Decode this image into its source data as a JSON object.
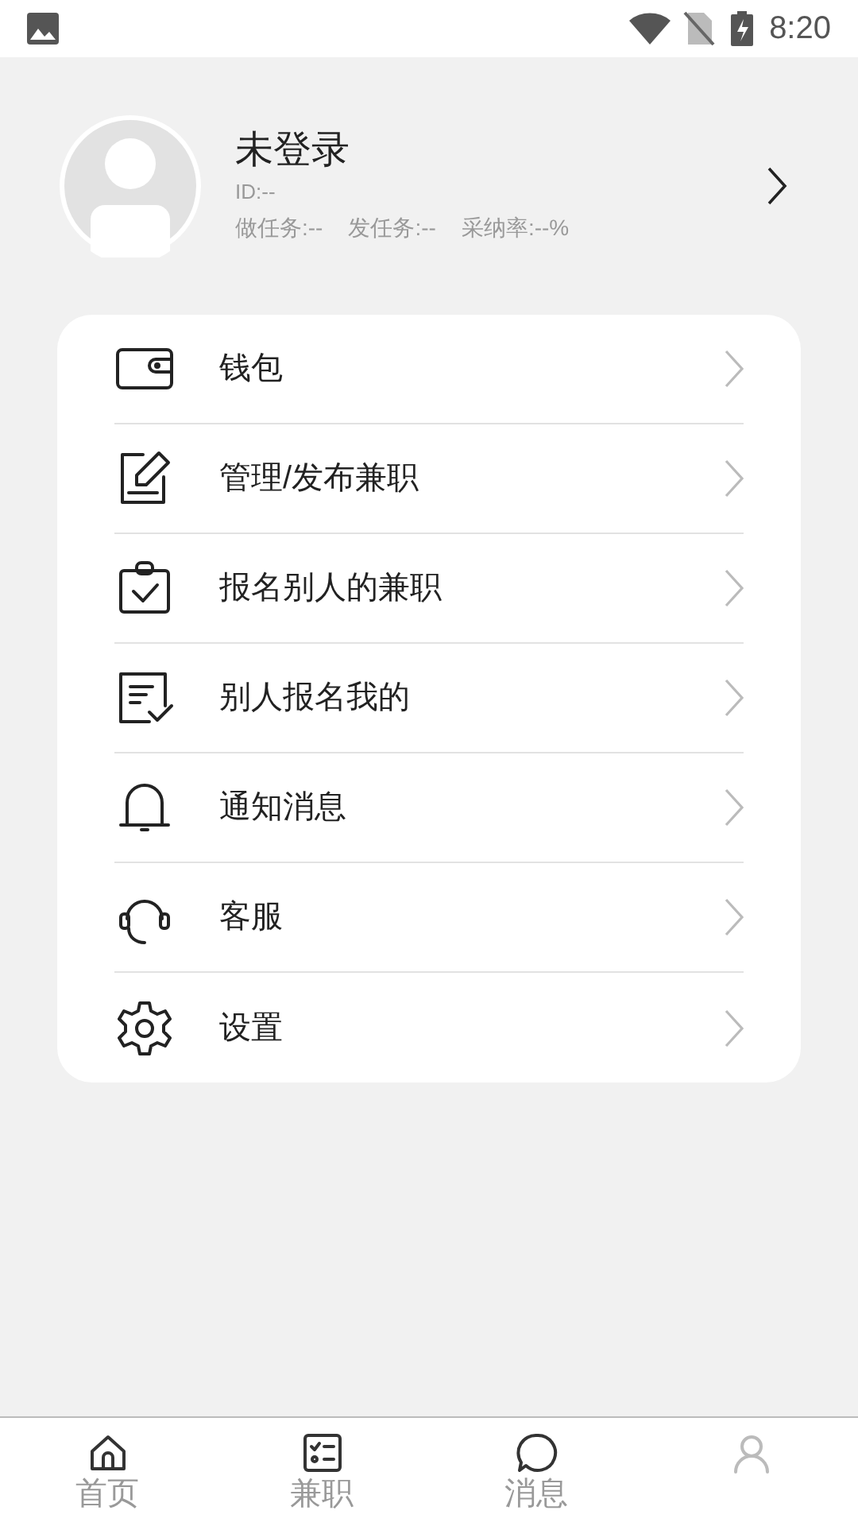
{
  "status_bar": {
    "time": "8:20"
  },
  "profile": {
    "name": "未登录",
    "id": "ID:--",
    "stats": [
      "做任务:--",
      "发任务:--",
      "采纳率:--%"
    ]
  },
  "menu": [
    {
      "label": "钱包"
    },
    {
      "label": "管理/发布兼职"
    },
    {
      "label": "报名别人的兼职"
    },
    {
      "label": "别人报名我的"
    },
    {
      "label": "通知消息"
    },
    {
      "label": "客服"
    },
    {
      "label": "设置"
    }
  ],
  "tab_bar": [
    {
      "kind": "labeled",
      "label": "首页"
    },
    {
      "kind": "labeled",
      "label": "兼职"
    },
    {
      "kind": "labeled",
      "label": "消息"
    },
    {
      "kind": "icon_only"
    }
  ]
}
